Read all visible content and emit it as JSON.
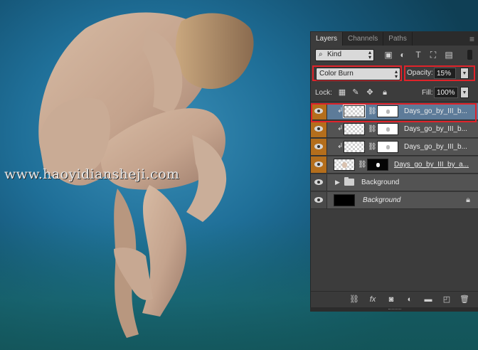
{
  "watermark": "www.haoyidiansheji.com",
  "panel": {
    "tabs": [
      {
        "label": "Layers",
        "active": true
      },
      {
        "label": "Channels",
        "active": false
      },
      {
        "label": "Paths",
        "active": false
      }
    ],
    "menu_icon": "panel-menu-icon",
    "filter": {
      "kind_label": "Kind",
      "icons": [
        "pixel-filter-icon",
        "adjustment-filter-icon",
        "type-filter-icon",
        "shape-filter-icon",
        "smart-object-filter-icon"
      ]
    },
    "blend_mode": "Color Burn",
    "opacity_label": "Opacity:",
    "opacity_value": "15%",
    "lock_label": "Lock:",
    "lock_icons": [
      "lock-transparent-icon",
      "lock-brush-icon",
      "lock-move-icon",
      "lock-all-icon"
    ],
    "fill_label": "Fill:",
    "fill_value": "100%",
    "layers": [
      {
        "name": "Days_go_by_III_b...",
        "selected": true,
        "clipped": true
      },
      {
        "name": "Days_go_by_III_b...",
        "selected": false,
        "clipped": true
      },
      {
        "name": "Days_go_by_III_b...",
        "selected": false,
        "clipped": true
      },
      {
        "name": "Days_go_by_III_by_a...",
        "selected": false,
        "clipped": false
      },
      {
        "name": "Background",
        "type": "group"
      },
      {
        "name": "Background",
        "type": "background",
        "locked": true
      }
    ],
    "footer_icons": [
      "link-layers-icon",
      "fx-icon",
      "add-mask-icon",
      "adjustment-layer-icon",
      "new-group-icon",
      "new-layer-icon",
      "trash-icon"
    ],
    "colors": {
      "highlight": "#e0232a",
      "visibility_orange": "#b46e1c",
      "selected_row": "#5d7b99"
    }
  }
}
